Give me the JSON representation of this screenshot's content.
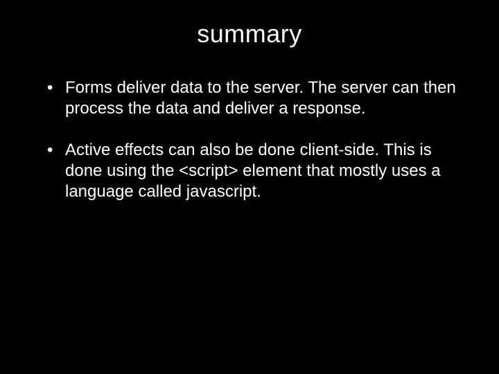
{
  "slide": {
    "title": "summary",
    "bullets": [
      "Forms deliver data to the server. The server can then process the data and deliver a response.",
      "Active effects can also be done client-side. This is done using the <script> element that mostly uses a language called javascript."
    ]
  }
}
